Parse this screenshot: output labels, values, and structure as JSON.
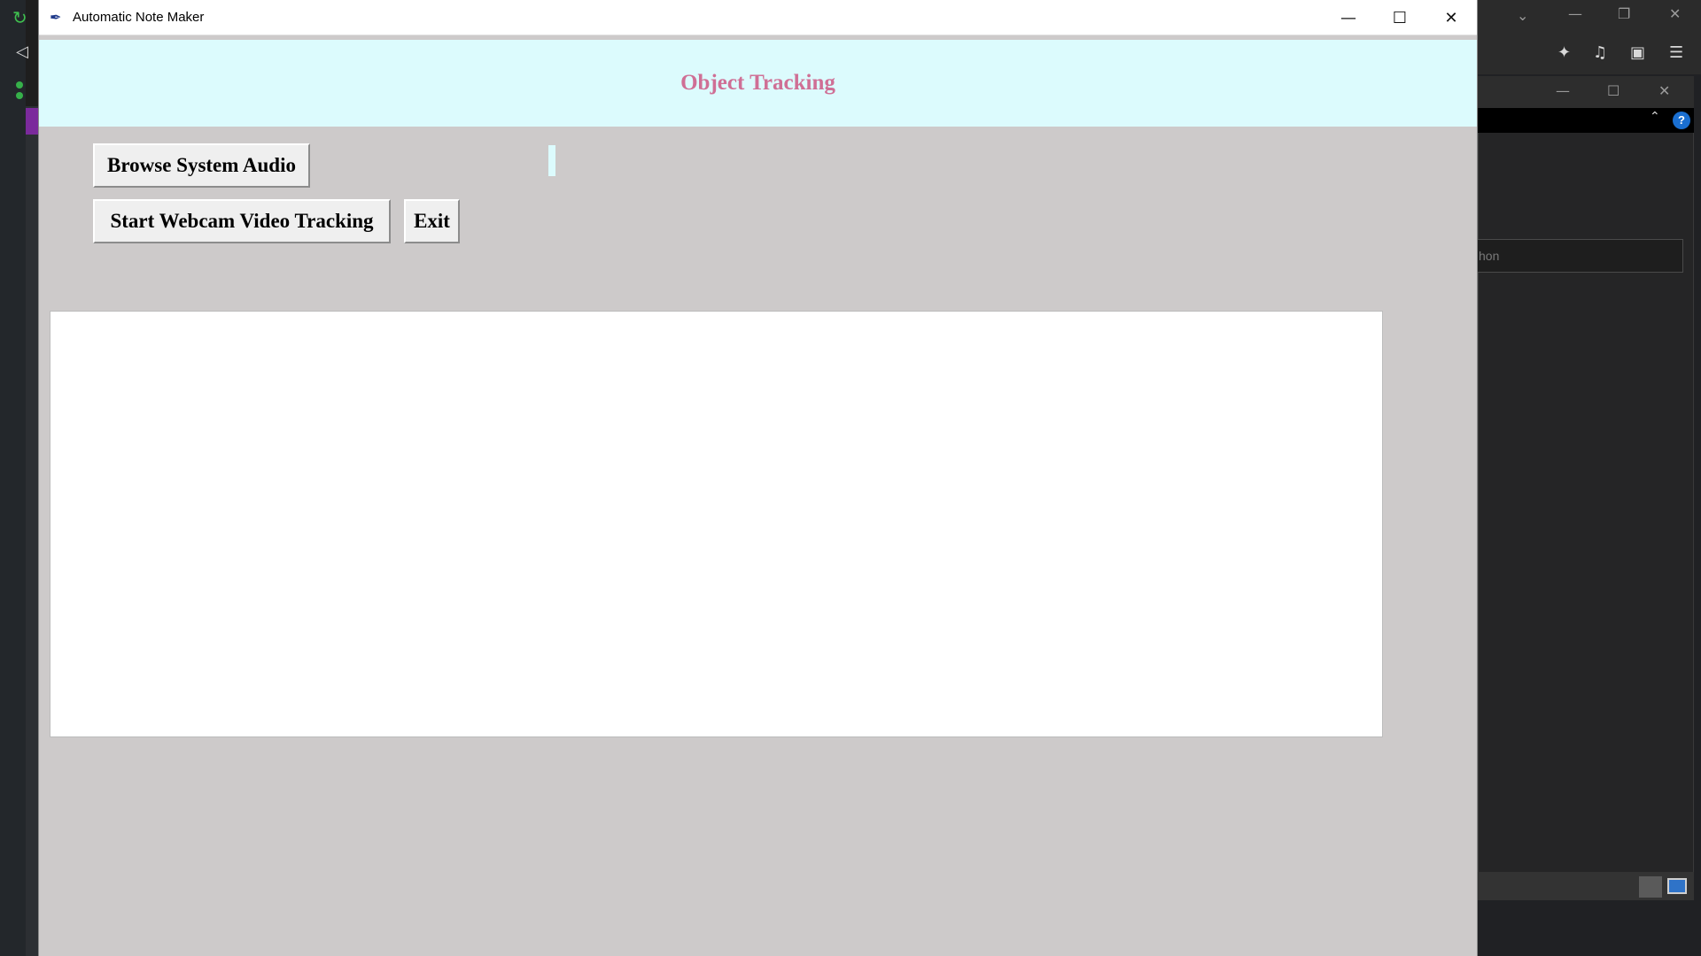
{
  "window": {
    "title": "Automatic Note Maker",
    "minimize_glyph": "—",
    "maximize_glyph": "☐",
    "close_glyph": "✕"
  },
  "header": {
    "title": "Object Tracking"
  },
  "buttons": {
    "browse_audio": "Browse System Audio",
    "webcam_tracking": "Start Webcam Video Tracking",
    "exit": "Exit"
  },
  "output": {
    "text": ""
  },
  "background": {
    "right_search_partial": "hon"
  },
  "colors": {
    "header_bg": "#dcfbfd",
    "header_text": "#cf6f95",
    "window_bg": "#cdcaca"
  }
}
